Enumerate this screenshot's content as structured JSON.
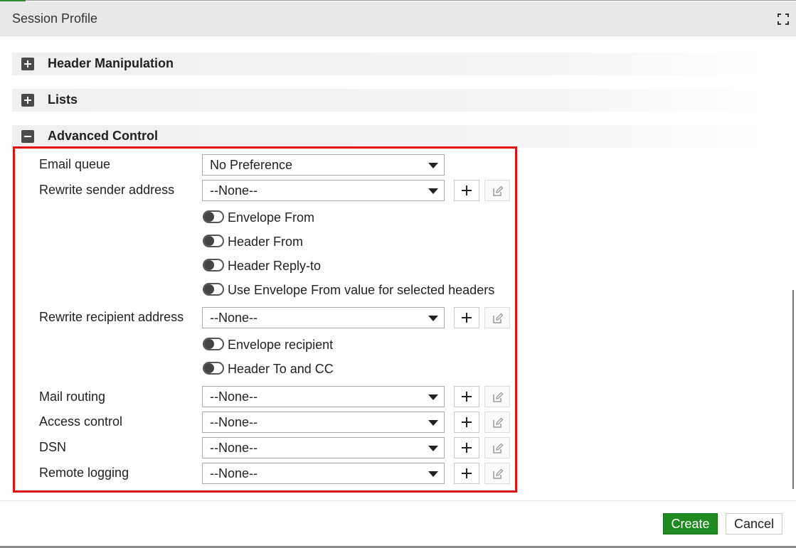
{
  "dialog": {
    "title": "Session Profile",
    "expand_icon": "expand-icon"
  },
  "sections": [
    {
      "label": "Header Manipulation",
      "state": "collapsed",
      "icon": "plus-square-icon"
    },
    {
      "label": "Lists",
      "state": "collapsed",
      "icon": "plus-square-icon"
    },
    {
      "label": "Advanced Control",
      "state": "expanded",
      "icon": "minus-square-icon"
    }
  ],
  "advanced": {
    "email_queue": {
      "label": "Email queue",
      "value": "No Preference"
    },
    "rewrite_sender": {
      "label": "Rewrite sender address",
      "value": "--None--",
      "toggles": [
        {
          "label": "Envelope From",
          "on": false
        },
        {
          "label": "Header From",
          "on": false
        },
        {
          "label": "Header Reply-to",
          "on": false
        },
        {
          "label": "Use Envelope From value for selected headers",
          "on": false
        }
      ]
    },
    "rewrite_recipient": {
      "label": "Rewrite recipient address",
      "value": "--None--",
      "toggles": [
        {
          "label": "Envelope recipient",
          "on": false
        },
        {
          "label": "Header To and CC",
          "on": false
        }
      ]
    },
    "mail_routing": {
      "label": "Mail routing",
      "value": "--None--"
    },
    "access_control": {
      "label": "Access control",
      "value": "--None--"
    },
    "dsn": {
      "label": "DSN",
      "value": "--None--"
    },
    "remote_logging": {
      "label": "Remote logging",
      "value": "--None--"
    }
  },
  "footer": {
    "create_label": "Create",
    "cancel_label": "Cancel"
  },
  "colors": {
    "highlight": "#e01010",
    "create_button": "#1f8a1f"
  }
}
